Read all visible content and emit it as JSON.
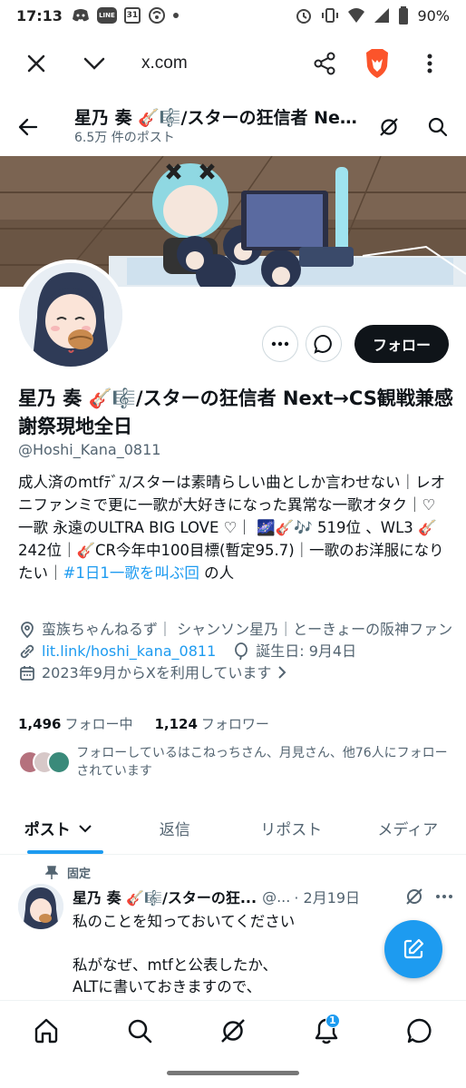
{
  "status_bar": {
    "time": "17:13",
    "battery": "90%",
    "calendar_day": "31",
    "line_label": "LINE"
  },
  "browser": {
    "url": "x.com"
  },
  "profile_header": {
    "name": "星乃 奏 🎸🎼/スターの狂信者 Next→CS観戦兼感謝祭現地全日",
    "post_count": "6.5万 件のポスト"
  },
  "actions": {
    "follow_label": "フォロー"
  },
  "profile": {
    "display_name": "星乃 奏 🎸🎼/スターの狂信者 Next→CS観戦兼感謝祭現地全日",
    "handle": "@Hoshi_Kana_0811",
    "bio_text": "成人済のmtfﾃﾞｽ/スターは素晴らしい曲としか言わせない｜レオニファンミで更に一歌が大好きになった異常な一歌オタク｜♡ 一歌 永遠のULTRA BIG LOVE ♡｜ 🌌🎸🎶 519位 、WL3 🎸242位｜🎸CR今年中100目標(暫定95.7)｜一歌のお洋服になりたい｜",
    "bio_hashtag": "#1日1一歌を叫ぶ回",
    "bio_tail": " の人",
    "location": "蛮族ちゃんねるず｜ シャンソン星乃｜とーきょーの阪神ファン",
    "website": "lit.link/hoshi_kana_0811",
    "birthday": "誕生日: 9月4日",
    "joined": "2023年9月からXを利用しています",
    "following_count": "1,496",
    "following_label": "フォロー中",
    "followers_count": "1,124",
    "followers_label": "フォロワー",
    "followed_by": "フォローしているはこねっちさん、月見さん、他76人にフォローされています"
  },
  "tabs": [
    "ポスト",
    "返信",
    "リポスト",
    "メディア"
  ],
  "tweet": {
    "pinned_label": "固定",
    "name": "星乃 奏 🎸🎼/スターの狂...",
    "handle": "@...",
    "date": "· 2月19日",
    "line1": "私のことを知っておいてください",
    "line2": "私がなぜ、mtfと公表したか、",
    "line3": "ALTに書いておきますので、"
  },
  "bottom_nav": {
    "notification_badge": "1"
  },
  "colors": {
    "accent": "#1d9bf0",
    "text": "#0f1419",
    "muted": "#536471"
  }
}
